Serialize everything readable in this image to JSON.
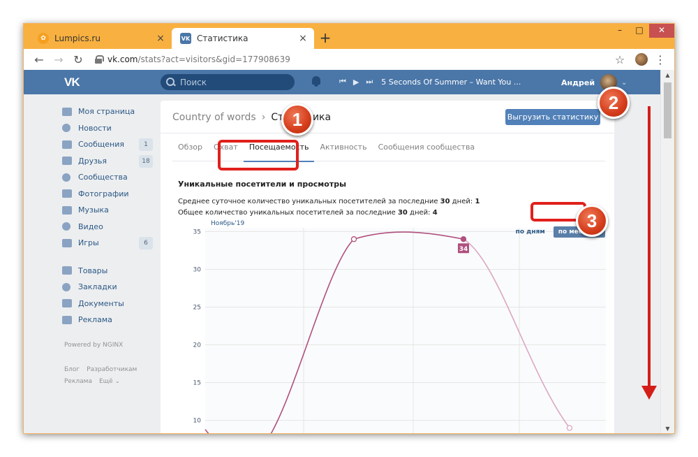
{
  "browser": {
    "tabs": [
      {
        "title": "Lumpics.ru",
        "active": false
      },
      {
        "title": "Статистика",
        "active": true
      }
    ],
    "address": {
      "host": "vk.com",
      "path": "/stats?act=visitors&gid=177908639"
    },
    "new_tab_label": "+",
    "close_label": "×",
    "min_label": "–",
    "max_label": "□",
    "win_close_label": "✕"
  },
  "vk": {
    "search_placeholder": "Поиск",
    "track": "5 Seconds Of Summer – Want You ...",
    "user_name": "Андрей",
    "menu": [
      {
        "label": "Моя страница",
        "icon": "home-icon",
        "counter": ""
      },
      {
        "label": "Новости",
        "icon": "news-icon",
        "counter": ""
      },
      {
        "label": "Сообщения",
        "icon": "messages-icon",
        "counter": "1"
      },
      {
        "label": "Друзья",
        "icon": "friends-icon",
        "counter": "18"
      },
      {
        "label": "Сообщества",
        "icon": "communities-icon",
        "counter": ""
      },
      {
        "label": "Фотографии",
        "icon": "camera-icon",
        "counter": ""
      },
      {
        "label": "Музыка",
        "icon": "music-icon",
        "counter": ""
      },
      {
        "label": "Видео",
        "icon": "video-icon",
        "counter": ""
      },
      {
        "label": "Игры",
        "icon": "gamepad-icon",
        "counter": "6"
      }
    ],
    "menu2": [
      {
        "label": "Товары",
        "icon": "bag-icon"
      },
      {
        "label": "Закладки",
        "icon": "star-icon"
      },
      {
        "label": "Документы",
        "icon": "document-icon"
      },
      {
        "label": "Реклама",
        "icon": "megaphone-icon"
      }
    ],
    "powered": "Powered by NGINX",
    "footer": [
      "Блог",
      "Разработчикам",
      "Реклама",
      "Ещё ⌄"
    ]
  },
  "content": {
    "breadcrumb_group": "Country of words",
    "breadcrumb_page": "Статистика",
    "export_label": "Выгрузить статистику",
    "tabs": [
      "Обзор",
      "Охват",
      "Посещаемость",
      "Активность",
      "Сообщения сообщества"
    ],
    "active_tab": "Посещаемость",
    "section_title": "Уникальные посетители и просмотры",
    "avg_prefix": "Среднее суточное количество уникальных посетителей за последние ",
    "avg_days": "30",
    "avg_mid": " дней: ",
    "avg_value": "1",
    "total_prefix": "Общее количество уникальных посетителей за последние ",
    "total_days": "30",
    "total_mid": " дней: ",
    "total_value": "4",
    "by_days": "по дням",
    "by_months": "по месяцам"
  },
  "chart_data": {
    "type": "line",
    "x_label_top": "Ноябрь'19",
    "y_ticks": [
      10,
      15,
      20,
      25,
      30,
      35
    ],
    "ylim": [
      7,
      35.5
    ],
    "points": [
      {
        "x": 0,
        "y": 8.8
      },
      {
        "x": 1,
        "y": 7.0
      },
      {
        "x": 2,
        "y": 7.0
      },
      {
        "x": 3,
        "y": 34
      },
      {
        "x": 4,
        "y": 34
      },
      {
        "x": 5,
        "y": 9
      }
    ],
    "highlight_label": "34",
    "colors": {
      "line": "#b0507e",
      "line_fade": "#dba8c2",
      "grid": "#e5e5e5"
    }
  },
  "annotations": {
    "badge1": "1",
    "badge2": "2",
    "badge3": "3"
  }
}
